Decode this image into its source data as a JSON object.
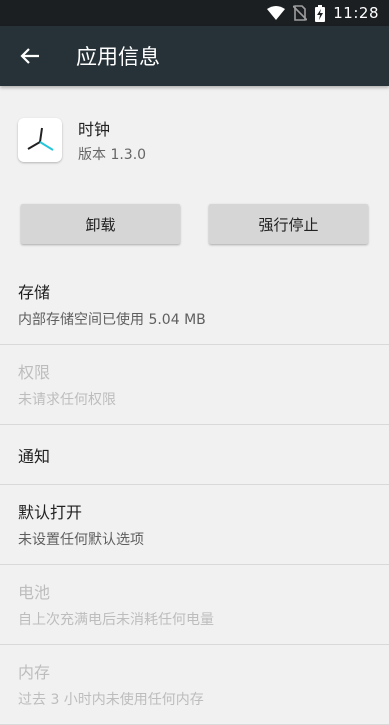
{
  "status_bar": {
    "time": "11:28"
  },
  "app_bar": {
    "title": "应用信息"
  },
  "app": {
    "name": "时钟",
    "version": "版本 1.3.0"
  },
  "buttons": {
    "uninstall": "卸载",
    "force_stop": "强行停止"
  },
  "items": [
    {
      "title": "存储",
      "subtitle": "内部存储空间已使用 5.04 MB",
      "enabled": true
    },
    {
      "title": "权限",
      "subtitle": "未请求任何权限",
      "enabled": false
    },
    {
      "title": "通知",
      "enabled": true
    },
    {
      "title": "默认打开",
      "subtitle": "未设置任何默认选项",
      "enabled": true
    },
    {
      "title": "电池",
      "subtitle": "自上次充满电后未消耗任何电量",
      "enabled": false
    },
    {
      "title": "内存",
      "subtitle": "过去 3 小时内未使用任何内存",
      "enabled": false
    }
  ]
}
